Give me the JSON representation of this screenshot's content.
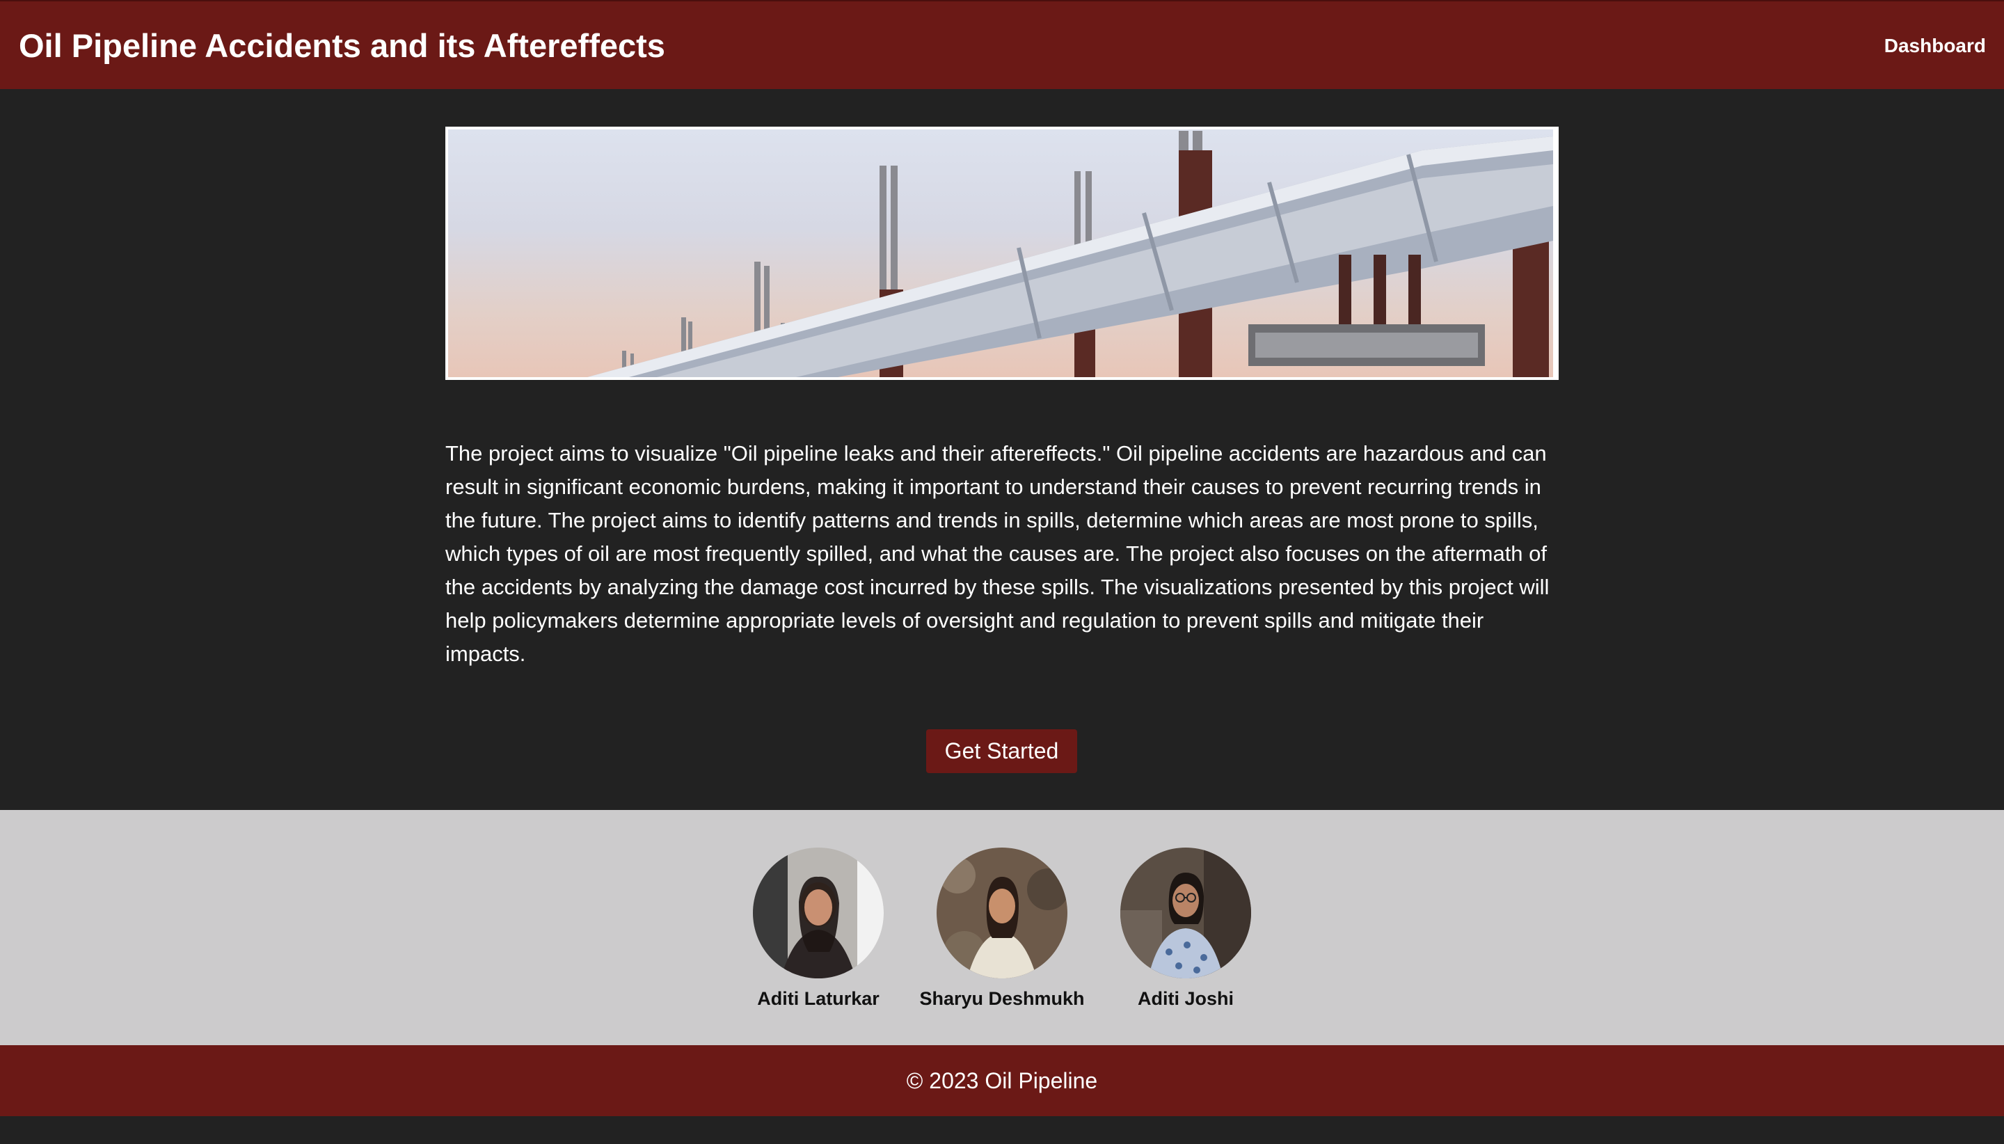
{
  "header": {
    "title": "Oil Pipeline Accidents and its Aftereffects",
    "nav_dashboard": "Dashboard"
  },
  "hero": {
    "image": "oil-pipeline-photo"
  },
  "description": "The project aims to visualize \"Oil pipeline leaks and their aftereffects.\" Oil pipeline accidents are hazardous and can result in significant economic burdens, making it important to understand their causes to prevent recurring trends in the future. The project aims to identify patterns and trends in spills, determine which areas are most prone to spills, which types of oil are most frequently spilled, and what the causes are. The project also focuses on the aftermath of the accidents by analyzing the damage cost incurred by these spills. The visualizations presented by this project will help policymakers determine appropriate levels of oversight and regulation to prevent spills and mitigate their impacts.",
  "cta": {
    "label": "Get Started"
  },
  "team": {
    "members": [
      {
        "name": "Aditi Laturkar"
      },
      {
        "name": "Sharyu Deshmukh"
      },
      {
        "name": "Aditi Joshi"
      }
    ]
  },
  "footer": {
    "text": "© 2023 Oil Pipeline"
  },
  "colors": {
    "brand": "#6b1916",
    "background": "#222222",
    "team_background": "#cccbcc"
  }
}
